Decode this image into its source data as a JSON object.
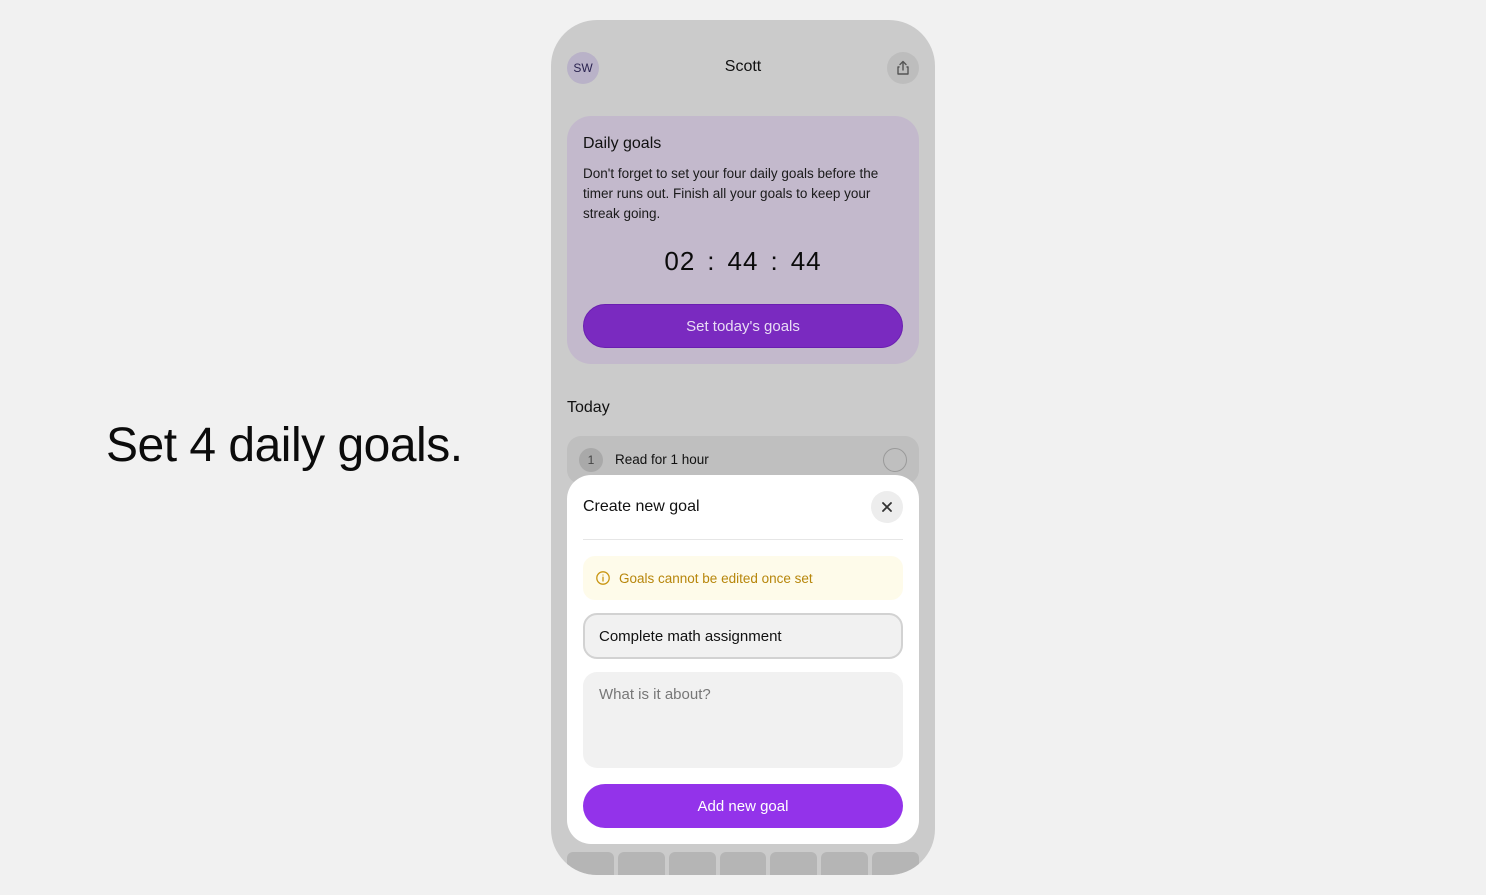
{
  "headline": "Set 4 daily goals.",
  "header": {
    "avatar_initials": "SW",
    "user_name": "Scott"
  },
  "daily_goals_card": {
    "title": "Daily goals",
    "description": "Don't forget to set your four daily goals before the timer runs out. Finish all your goals to keep your streak going.",
    "timer": {
      "hours": "02",
      "minutes": "44",
      "seconds": "44",
      "separator": ":"
    },
    "button_label": "Set today's goals"
  },
  "today": {
    "label": "Today",
    "items": [
      {
        "number": "1",
        "text": "Read for 1 hour"
      }
    ]
  },
  "modal": {
    "title": "Create new goal",
    "notice": "Goals cannot be edited once set",
    "title_input_value": "Complete math assignment",
    "description_placeholder": "What is it about?",
    "submit_label": "Add new goal"
  },
  "colors": {
    "primary": "#9333ea",
    "card": "#c3b9cc",
    "notice_text": "#b7860b",
    "notice_bg": "#fefbea"
  },
  "icons": {
    "share": "share-icon",
    "close": "close-icon",
    "info": "info-icon"
  }
}
